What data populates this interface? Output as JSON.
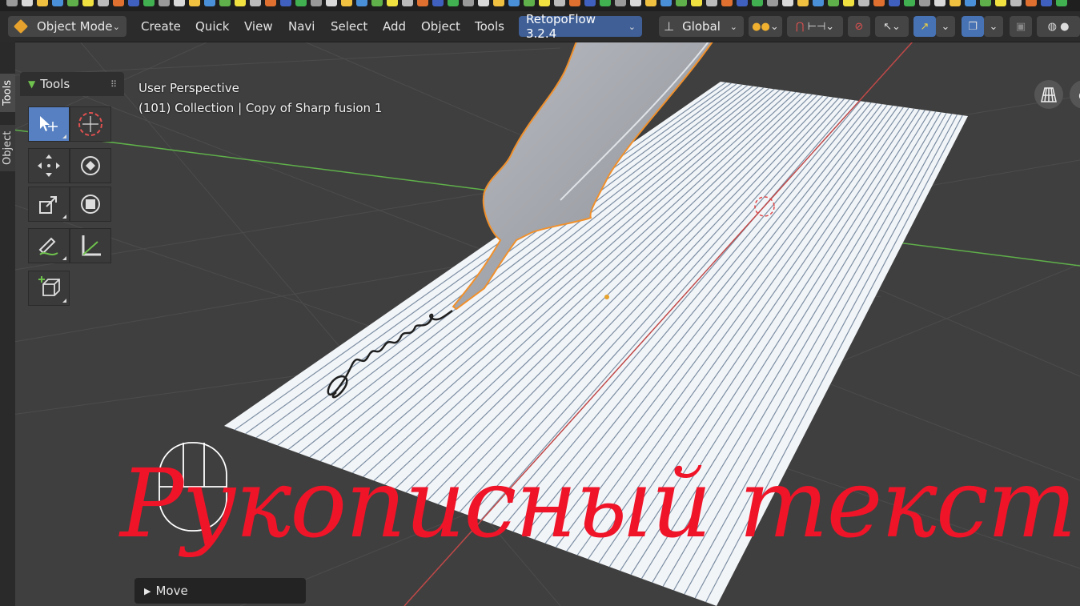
{
  "header": {
    "mode": "Object Mode",
    "menus": [
      "Create",
      "Quick",
      "View",
      "Navi",
      "Select",
      "Add",
      "Object",
      "Tools"
    ],
    "addon": "RetopoFlow 3.2.4",
    "transform_orientation": "Global"
  },
  "side_tabs": [
    "Tools",
    "Object"
  ],
  "tools_panel": {
    "title": "Tools",
    "tools": [
      "select-box",
      "cursor",
      "move",
      "rotate",
      "scale",
      "transform",
      "annotate",
      "measure",
      "add-cube"
    ]
  },
  "viewport": {
    "view_name": "User Perspective",
    "collection_info": "(101) Collection | Copy of Sharp fusion 1",
    "overlay_title": "Рукописный текст",
    "handwriting_color": "#1f1f1f",
    "paper_color": "#f2f5f8",
    "feather_outline_color": "#f0902c"
  },
  "operator_panel": {
    "label": "Move"
  },
  "colors": {
    "accent_blue": "#4772b3",
    "title_red": "#f01428",
    "x_axis": "#c04848",
    "y_axis": "#5fb04a"
  }
}
